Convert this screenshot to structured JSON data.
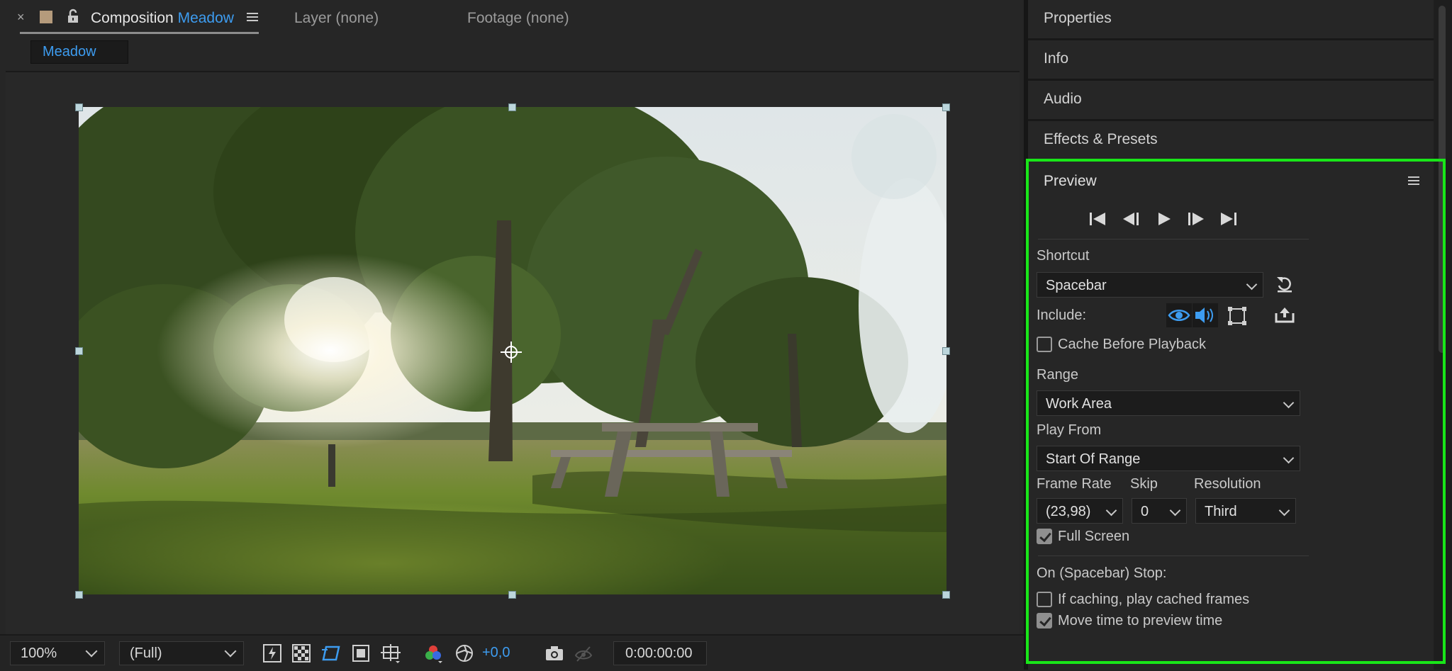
{
  "comp_tabs": {
    "close_glyph": "×",
    "active_prefix": "Composition",
    "active_name": "Meadow",
    "layer_tab": "Layer (none)",
    "footage_tab": "Footage (none)",
    "label_color": "#b59b7c",
    "accent": "#3d9cf0"
  },
  "breadcrumb": {
    "label": "Meadow"
  },
  "viewer_toolbar": {
    "zoom": "100%",
    "resolution": "(Full)",
    "exposure": "+0,0",
    "timecode": "0:00:00:00"
  },
  "panels": {
    "properties": "Properties",
    "info": "Info",
    "audio": "Audio",
    "effects": "Effects & Presets"
  },
  "preview": {
    "title": "Preview",
    "shortcut_label": "Shortcut",
    "shortcut_value": "Spacebar",
    "include_label": "Include:",
    "cache_label": "Cache Before Playback",
    "cache_checked": false,
    "range_label": "Range",
    "range_value": "Work Area",
    "play_from_label": "Play From",
    "play_from_value": "Start Of Range",
    "frame_rate_label": "Frame Rate",
    "frame_rate_value": "(23,98)",
    "skip_label": "Skip",
    "skip_value": "0",
    "resolution_label": "Resolution",
    "resolution_value": "Third",
    "full_screen_label": "Full Screen",
    "full_screen_checked": true,
    "on_stop_label": "On (Spacebar) Stop:",
    "if_caching_label": "If caching, play cached frames",
    "if_caching_checked": false,
    "move_time_label": "Move time to preview time",
    "move_time_checked": true,
    "highlight_color": "#19e619"
  }
}
